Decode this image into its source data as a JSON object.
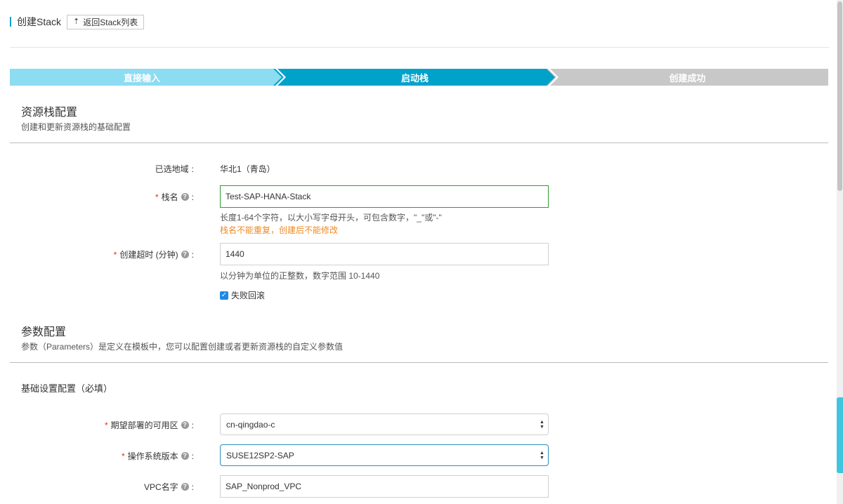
{
  "header": {
    "title": "创建Stack",
    "back_button": "返回Stack列表",
    "back_icon": "upload-arrow-icon"
  },
  "steps": [
    {
      "label": "直接输入",
      "state": "done"
    },
    {
      "label": "启动栈",
      "state": "active"
    },
    {
      "label": "创建成功",
      "state": "pending"
    }
  ],
  "stack_config": {
    "title": "资源栈配置",
    "desc": "创建和更新资源栈的基础配置",
    "region_label": "已选地域",
    "region_value": "华北1（青岛）",
    "name_label": "栈名",
    "name_value": "Test-SAP-HANA-Stack",
    "name_hint": "长度1-64个字符，以大小写字母开头，可包含数字，\"_\"或\"-\"",
    "name_warn": "栈名不能重复，创建后不能修改",
    "timeout_label": "创建超时 (分钟)",
    "timeout_value": "1440",
    "timeout_hint": "以分钟为单位的正整数，数字范围 10-1440",
    "rollback_label": "失败回滚",
    "rollback_checked": true
  },
  "params": {
    "title": "参数配置",
    "desc": "参数（Parameters）是定义在模板中，您可以配置创建或者更新资源栈的自定义参数值",
    "group_title": "基础设置配置（必填）",
    "zone_label": "期望部署的可用区",
    "zone_value": "cn-qingdao-c",
    "os_label": "操作系统版本",
    "os_value": "SUSE12SP2-SAP",
    "vpc_label": "VPC名字",
    "vpc_value": "SAP_Nonprod_VPC"
  },
  "colors": {
    "accent": "#00a2ca",
    "step_done": "#8cdcf2",
    "step_pending": "#c8c8c8",
    "required": "#e0301e",
    "warning": "#f08a24"
  }
}
